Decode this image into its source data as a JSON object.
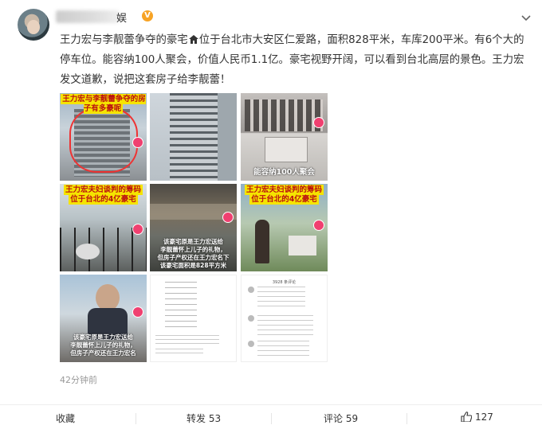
{
  "header": {
    "username": "娱",
    "badge": "V"
  },
  "post": {
    "text": "王力宏与李靓蕾争夺的豪宅位于台北市大安区仁爱路，面积828平米，车库200平米。有6个大的停车位。能容纳100人聚会，价值人民币1.1亿。豪宅视野开阔，可以看到台北高层的景色。王力宏发文道歉，说把这套房子给李靓蕾！",
    "text_part1": "王力宏与李靓蕾争夺的豪宅",
    "text_part2": "位于台北市大安区仁爱路，面积828平米，车库200平米。有6个大的停车位。能容纳100人聚会，价值人民币1.1亿。豪宅视野开阔，可以看到台北高层的景色。王力宏发文道歉，说把这套房子给李靓蕾！"
  },
  "images": {
    "img1_caption": "王力宏与李靓蕾争夺的房子有多豪呢",
    "img3_caption": "能容纳100人聚会",
    "img4_banner_1": "王力宏夫妇谈判的筹码",
    "img4_banner_2": "位于台北的4亿豪宅",
    "img5_caption_1": "该豪宅原是王力宏送给",
    "img5_caption_2": "李靓蕾怀上儿子的礼物，",
    "img5_caption_3": "但房子产权还在王力宏名下",
    "img5_caption_4": "该豪宅面积是828平方米",
    "img6_banner_1": "王力宏夫妇谈判的筹码",
    "img6_banner_2": "位于台北的4亿豪宅",
    "img7_caption_1": "该豪宅原是王力宏送给",
    "img7_caption_2": "李靓蕾怀上儿子的礼物，",
    "img7_caption_3": "但房子产权还在王力宏名",
    "img9_header": "3928 条评论"
  },
  "timestamp": "42分钟前",
  "actions": {
    "favorite": "收藏",
    "repost": "转发 53",
    "comment": "评论 59",
    "like": "127"
  }
}
